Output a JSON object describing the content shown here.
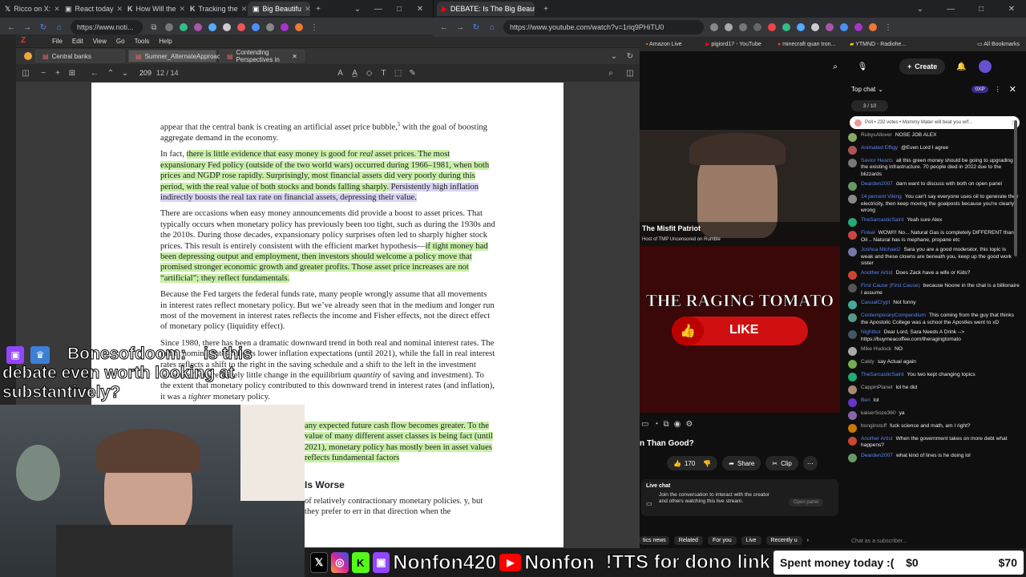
{
  "left_browser": {
    "tabs": [
      {
        "label": "Ricco on X:"
      },
      {
        "label": "React today"
      },
      {
        "label": "How Will the"
      },
      {
        "label": "Tracking the"
      },
      {
        "label": "Big Beautifu",
        "active": true
      }
    ],
    "url": "https://www.noti..."
  },
  "right_browser": {
    "tabs": [
      {
        "label": "DEBATE: Is The Big Beautifu",
        "active": true
      }
    ],
    "url": "https://www.youtube.com/watch?v=1riq9PHiTU0",
    "bookmarks": [
      "Amazon Live",
      "pigiord17 - YouTube",
      "minecraft quan tron...",
      "YTMND - Radiohe..."
    ],
    "all_bookmarks": "All Bookmarks"
  },
  "zotero": {
    "menu": [
      "File",
      "Edit",
      "View",
      "Go",
      "Tools",
      "Help"
    ],
    "tabs": [
      {
        "label": "Central banks"
      },
      {
        "label": "Sumner_AlternateApproac",
        "active": true
      },
      {
        "label": "Contending Perspectives in"
      }
    ],
    "page_number": "209",
    "page_count": "12 / 14"
  },
  "document": {
    "p1": "appear that the central bank is creating an artificial asset price bubble,",
    "p1_sup": "5",
    "p1_end": " with the goal of boosting aggregate demand in the economy.",
    "p2_a": "In fact, ",
    "p2_hl1": "there is little evidence that easy money is good for ",
    "p2_real": "real",
    "p2_hl2": " asset prices. The most expansionary Fed policy (outside of the two world wars) occurred during 1966–1981, when both prices and NGDP rose rapidly. Surprisingly, most financial assets did very poorly during this period, with the real value of both stocks and bonds falling sharply.",
    "p2_hl3": " Persistently high inflation indirectly boosts the real tax rate on financial assets, depressing their value.",
    "p3_a": "There are occasions when easy money announcements did provide a boost to asset prices. That typically occurs when monetary policy has previously been too tight, such as during the 1930s and the 2010s. During those decades, expansionary policy surprises often led to sharply higher stock prices. This result is entirely consistent with the efficient market hypothesis—",
    "p3_hl": "if tight money had been depressing output and employment, then investors should welcome a policy move that promised stronger economic growth and greater profits. Those asset price increases are not “artificial”; they reflect fundamentals.",
    "p4": "Because the Fed targets the federal funds rate, many people wrongly assume that all movements in interest rates reflect monetary policy. But we’ve already seen that in the medium and longer run most of the movement in interest rates reflects the income and Fisher effects, not the direct effect of monetary policy (liquidity effect).",
    "p5": "Since 1980, there has been a dramatic downward trend in both real and nominal interest rates. The fall in nominal rates reflects lower inflation expectations (until 2021), while the fall in real interest rates reflects a shift to the right in the saving schedule and a shift to the left in the investment schedule (with relatively little change in the equilibrium ",
    "p5_quantity": "quantity",
    "p5_b": " of saving and investment). To the extent that monetary policy contributed to this downward trend in interest rates (and inflation), it was a ",
    "p5_tighter": "tighter",
    "p5_c": " monetary policy.",
    "p6_hl": "any expected future cash flow becomes greater. To the value of many different asset classes is being fact (until 2021), monetary policy has mostly been in asset values reflects fundamental factors",
    "heading": "Is Worse",
    "p7": "of relatively contractionary monetary policies. y, but they prefer to err in that direction when the"
  },
  "stream_overlay": {
    "chat_user": "Bonesofdoom:",
    "chat_text": " is this debate even worth looking at substantively?",
    "socials": [
      "Nonfon420",
      "Nonfon",
      "!TTS for dono link"
    ],
    "goal_label": "Spent money today :(",
    "goal_current": "$0",
    "goal_target": "$70"
  },
  "youtube": {
    "create_label": "Create",
    "streamer_name": "The Misfit Patriot",
    "streamer_sub": "Host of TMP Uncensored on Rumble",
    "banner_title": "THE RAGING TOMATO",
    "banner_like": "LIKE",
    "video_title_fragment": "n Than Good?",
    "likes": "170",
    "share": "Share",
    "clip": "Clip",
    "live_chat_title": "Live chat",
    "live_chat_desc": "Join the conversation to interact with the creator and others watching this live stream.",
    "open_panel": "Open panel",
    "tabs": [
      "tics news",
      "Related",
      "For you",
      "Live",
      "Recently u"
    ]
  },
  "chat": {
    "header": "Top chat",
    "badge": "3 / 10",
    "xp": "0XP",
    "poll": "Poll • 232 votes • Mommy Mater will beat you w/f...",
    "input_placeholder": "Chat as a subscriber...",
    "messages": [
      {
        "author": "RubysAllover",
        "text": "NOSE JOB ALEX",
        "color": "#8a6"
      },
      {
        "author": "Animated Effigy",
        "text": "@Even Lord I agree",
        "mod": true,
        "color": "#a55"
      },
      {
        "author": "Savior Hearts",
        "text": "all this green money should be going to upgrading the existing infrastructure. 70 people died in 2022 due to the blizzards",
        "mod": true,
        "color": "#777"
      },
      {
        "author": "Dearden2007",
        "text": "darn want to discuss with both on open panel",
        "mod": true,
        "color": "#696"
      },
      {
        "author": "14 percent Viking",
        "text": "You can't say everyone uses oil to generate their electricity, then keep moving the goalposts because you're clearly wrong",
        "mod": true,
        "color": "#888"
      },
      {
        "author": "TheSarcasticSaint",
        "text": "Yeah sure Alex",
        "mod": true,
        "color": "#2a7"
      },
      {
        "author": "Finkel",
        "text": "WOW!!! No... Natural Gas is completely DIFFERENT than Oil .. Natural has is mephane, propane etc",
        "mod": true,
        "color": "#c44"
      },
      {
        "author": "Joshua Michael2",
        "text": "Sara you are a good moderator, this topic is weak and these clowns are beneath you, keep up the good work sister",
        "mod": true,
        "color": "#77a"
      },
      {
        "author": "Another Artist",
        "text": "Does Zack have a wife or Kids?",
        "mod": true,
        "color": "#c43"
      },
      {
        "author": "First Cause (First Cause)",
        "text": "because Noone in the chat is a billionaire I assume",
        "mod": true,
        "color": "#555"
      },
      {
        "author": "CasualCrypt",
        "text": "Not funny",
        "mod": true,
        "color": "#4a9"
      },
      {
        "author": "ContemporaryCompendium",
        "text": "This coming from the guy that thinks the Apostolic College was a school the Apostles went to xD",
        "mod": true,
        "color": "#598"
      },
      {
        "author": "Nightbot",
        "text": "Dear Lord, Sara Needs A Drink --> https://buymeacoffee.com/theragingtomato",
        "mod": true,
        "color": "#456"
      },
      {
        "author": "Mike Hudock",
        "text": "NO",
        "color": "#aaa"
      },
      {
        "author": "Caldy",
        "text": "say Actual again",
        "color": "#7a5"
      },
      {
        "author": "TheSarcasticSaint",
        "text": "You two kept changing topics",
        "mod": true,
        "color": "#2a7"
      },
      {
        "author": "CappinPlanet",
        "text": "lol he did",
        "color": "#a87"
      },
      {
        "author": "Ben",
        "text": "lol",
        "mod": true,
        "color": "#63c"
      },
      {
        "author": "kaiserSoze360",
        "text": "ya",
        "color": "#86a"
      },
      {
        "author": "bonginstuff",
        "text": "fuck science and math, am I right?",
        "color": "#c70"
      },
      {
        "author": "Another Artist",
        "text": "When the government takes on more debt what happens?",
        "mod": true,
        "color": "#c43"
      },
      {
        "author": "Dearden2007",
        "text": "what kind of lines is he doing lol",
        "mod": true,
        "color": "#696"
      }
    ]
  }
}
